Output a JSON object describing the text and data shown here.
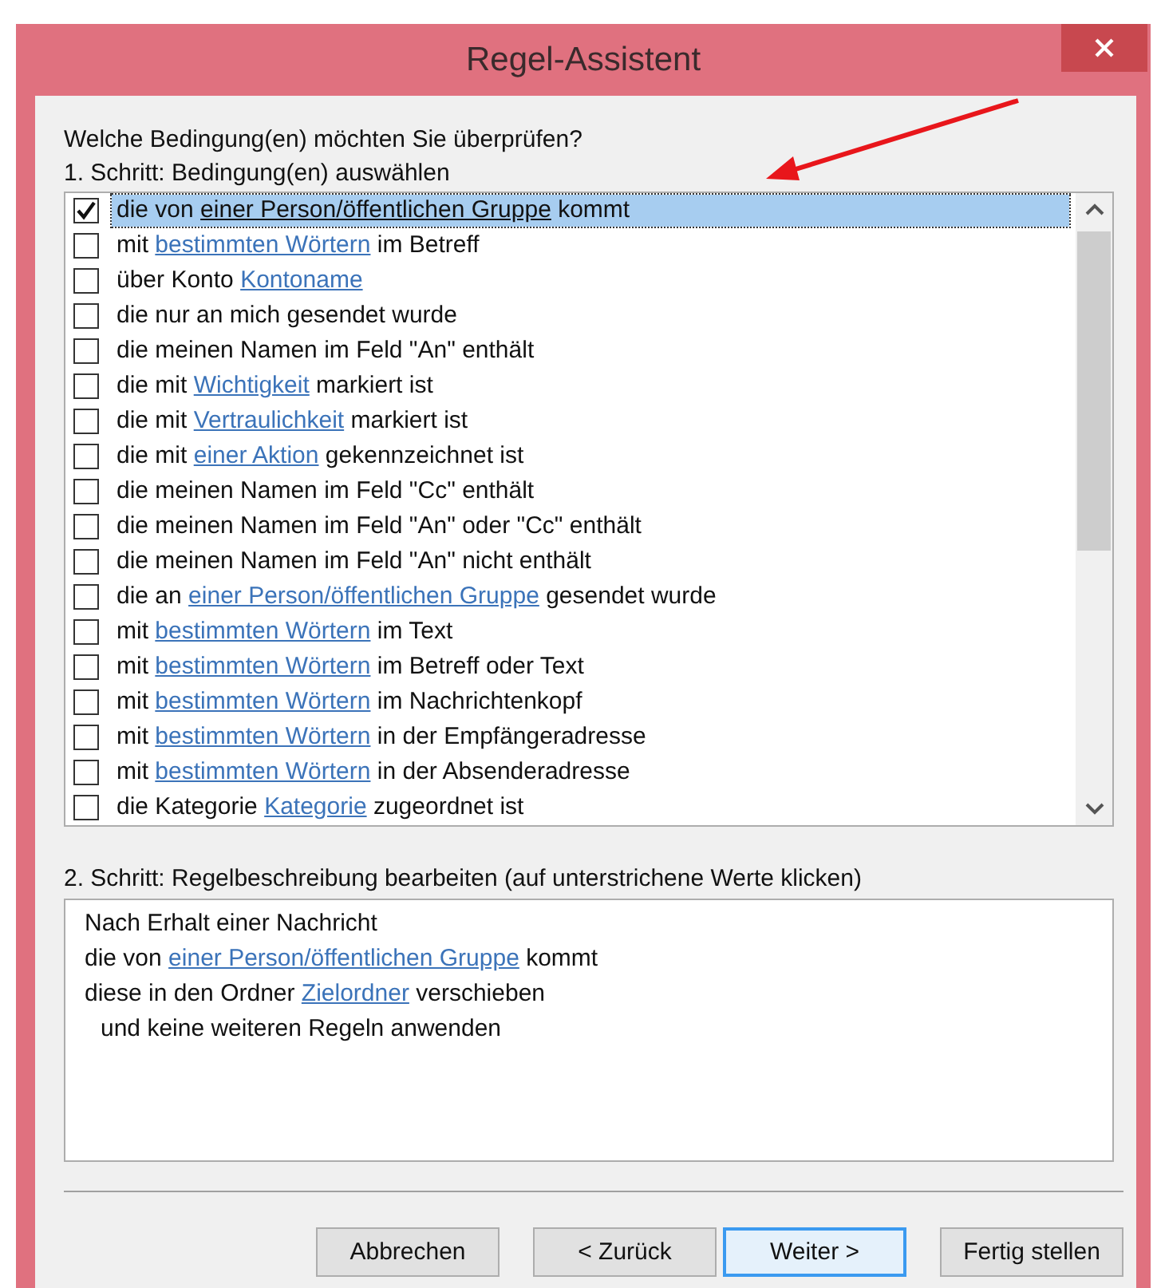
{
  "window": {
    "title": "Regel-Assistent"
  },
  "question": "Welche Bedingung(en) möchten Sie überprüfen?",
  "step1_label": "1. Schritt: Bedingung(en) auswählen",
  "conditions": [
    {
      "checked": true,
      "selected": true,
      "before": "die von ",
      "link": "einer Person/öffentlichen Gruppe",
      "after": " kommt"
    },
    {
      "checked": false,
      "selected": false,
      "before": "mit ",
      "link": "bestimmten Wörtern",
      "after": " im Betreff"
    },
    {
      "checked": false,
      "selected": false,
      "before": "über Konto ",
      "link": "Kontoname"
    },
    {
      "checked": false,
      "selected": false,
      "before": "die nur an mich gesendet wurde"
    },
    {
      "checked": false,
      "selected": false,
      "before": "die meinen Namen im Feld \"An\" enthält"
    },
    {
      "checked": false,
      "selected": false,
      "before": "die mit ",
      "link": "Wichtigkeit",
      "after": " markiert ist"
    },
    {
      "checked": false,
      "selected": false,
      "before": "die mit ",
      "link": "Vertraulichkeit",
      "after": " markiert ist"
    },
    {
      "checked": false,
      "selected": false,
      "before": "die mit ",
      "link": "einer Aktion",
      "after": " gekennzeichnet ist"
    },
    {
      "checked": false,
      "selected": false,
      "before": "die meinen Namen im Feld \"Cc\" enthält"
    },
    {
      "checked": false,
      "selected": false,
      "before": "die meinen Namen im Feld \"An\" oder \"Cc\" enthält"
    },
    {
      "checked": false,
      "selected": false,
      "before": "die meinen Namen im Feld \"An\" nicht enthält"
    },
    {
      "checked": false,
      "selected": false,
      "before": "die an ",
      "link": "einer Person/öffentlichen Gruppe",
      "after": " gesendet wurde"
    },
    {
      "checked": false,
      "selected": false,
      "before": "mit ",
      "link": "bestimmten Wörtern",
      "after": " im Text"
    },
    {
      "checked": false,
      "selected": false,
      "before": "mit ",
      "link": "bestimmten Wörtern",
      "after": " im Betreff oder Text"
    },
    {
      "checked": false,
      "selected": false,
      "before": "mit ",
      "link": "bestimmten Wörtern",
      "after": " im Nachrichtenkopf"
    },
    {
      "checked": false,
      "selected": false,
      "before": "mit ",
      "link": "bestimmten Wörtern",
      "after": " in der Empfängeradresse"
    },
    {
      "checked": false,
      "selected": false,
      "before": "mit ",
      "link": "bestimmten Wörtern",
      "after": " in der Absenderadresse"
    },
    {
      "checked": false,
      "selected": false,
      "before": "die Kategorie ",
      "link": "Kategorie",
      "after": " zugeordnet ist"
    }
  ],
  "step2_label": "2. Schritt: Regelbeschreibung bearbeiten (auf unterstrichene Werte klicken)",
  "description": [
    {
      "indented": false,
      "before": "Nach Erhalt einer Nachricht"
    },
    {
      "indented": false,
      "before": "die von ",
      "link": "einer Person/öffentlichen Gruppe",
      "after": " kommt"
    },
    {
      "indented": false,
      "before": "diese in den Ordner ",
      "link": "Zielordner",
      "after": " verschieben"
    },
    {
      "indented": true,
      "before": "und keine weiteren Regeln anwenden"
    }
  ],
  "buttons": [
    {
      "label": "Abbrechen",
      "focused": false
    },
    {
      "label": "< Zurück",
      "focused": false
    },
    {
      "label": "Weiter >",
      "focused": true
    },
    {
      "label": "Fertig stellen",
      "focused": false
    }
  ]
}
